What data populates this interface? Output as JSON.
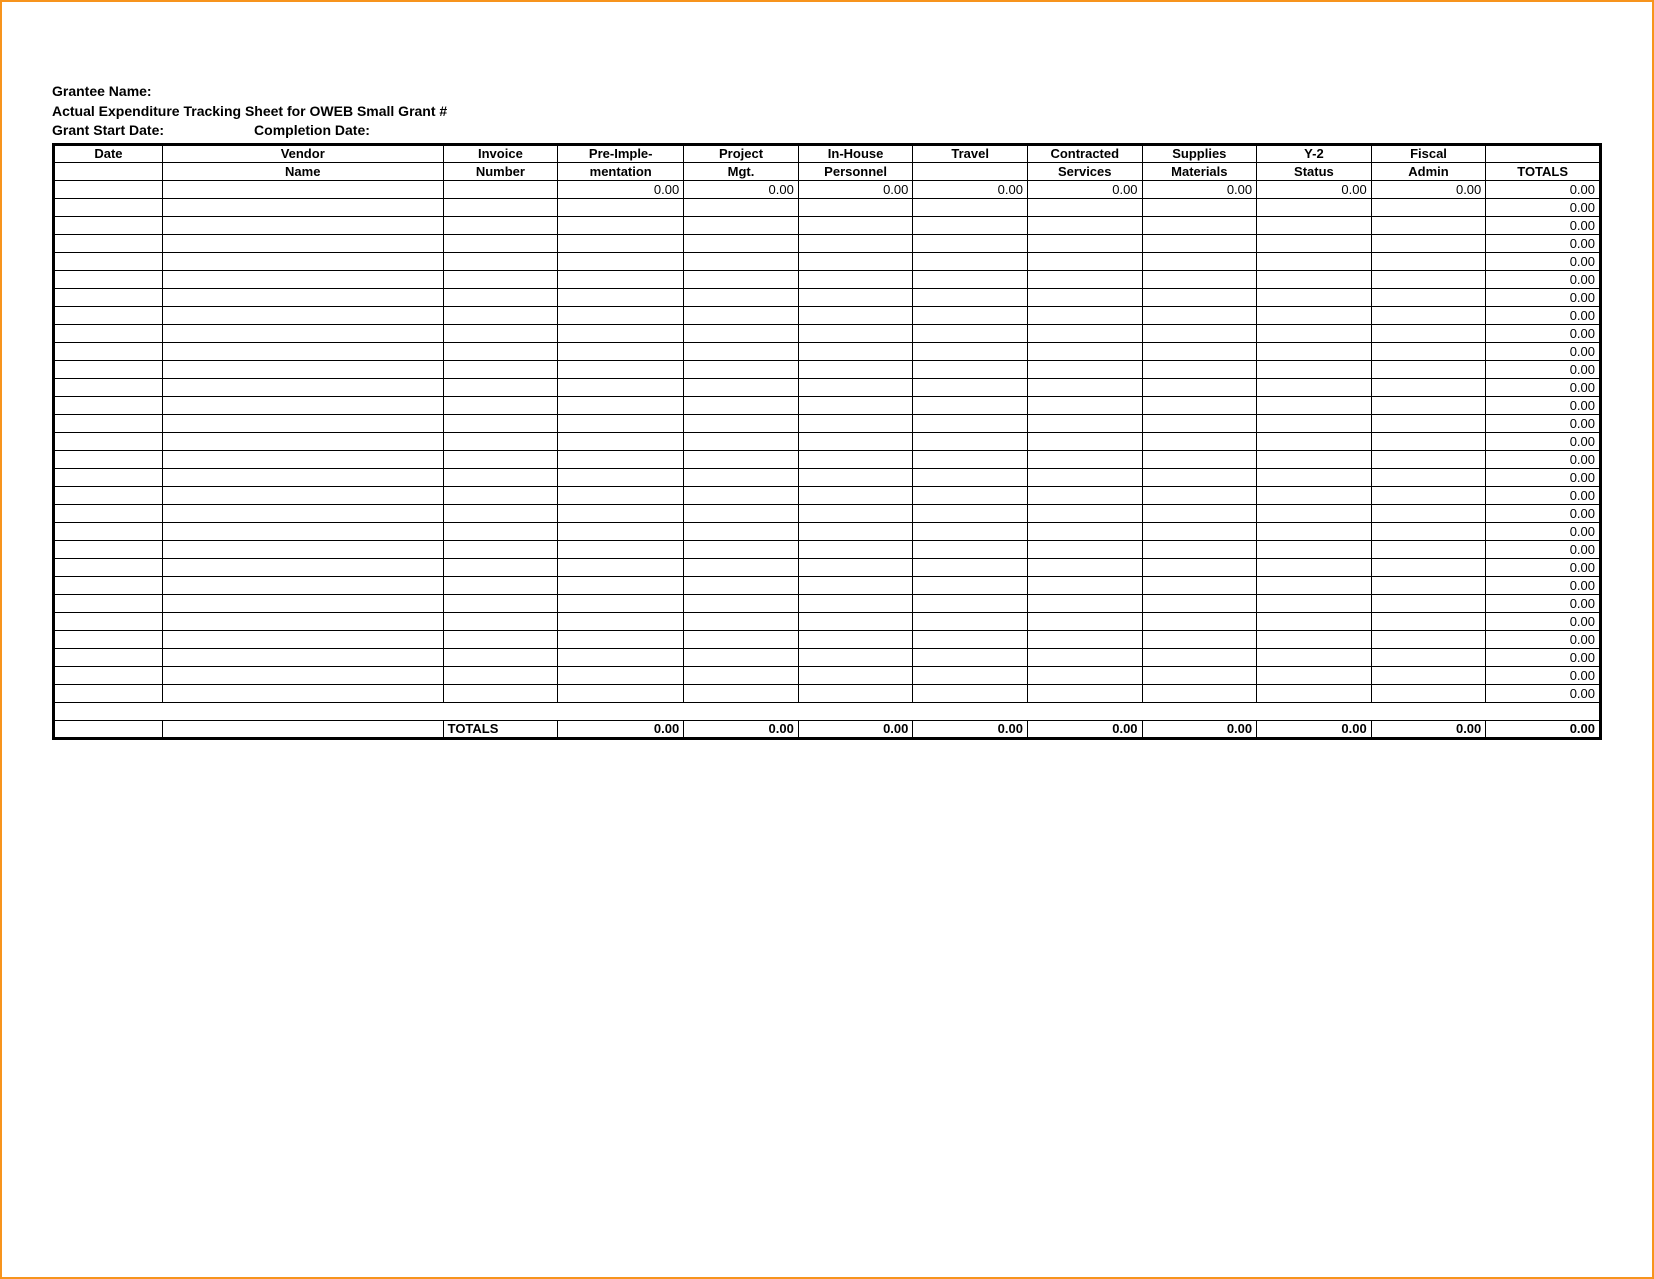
{
  "header": {
    "grantee_label": "Grantee Name:",
    "title": "Actual Expenditure Tracking Sheet for OWEB Small Grant #",
    "start_label": "Grant Start Date:",
    "completion_label": "Completion Date:"
  },
  "columns": {
    "row1": [
      "Date",
      "Vendor",
      "Invoice",
      "Pre-Imple-",
      "Project",
      "In-House",
      "Travel",
      "Contracted",
      "Supplies",
      "Y-2",
      "Fiscal",
      ""
    ],
    "row2": [
      "",
      "Name",
      "Number",
      "mentation",
      "Mgt.",
      "Personnel",
      "",
      "Services",
      "Materials",
      "Status",
      "Admin",
      "TOTALS"
    ]
  },
  "zero_row": [
    "",
    "",
    "",
    "0.00",
    "0.00",
    "0.00",
    "0.00",
    "0.00",
    "0.00",
    "0.00",
    "0.00",
    "0.00"
  ],
  "row_total_value": "0.00",
  "data_row_count": 28,
  "totals": {
    "label": "TOTALS",
    "values": [
      "0.00",
      "0.00",
      "0.00",
      "0.00",
      "0.00",
      "0.00",
      "0.00",
      "0.00",
      "0.00"
    ]
  }
}
